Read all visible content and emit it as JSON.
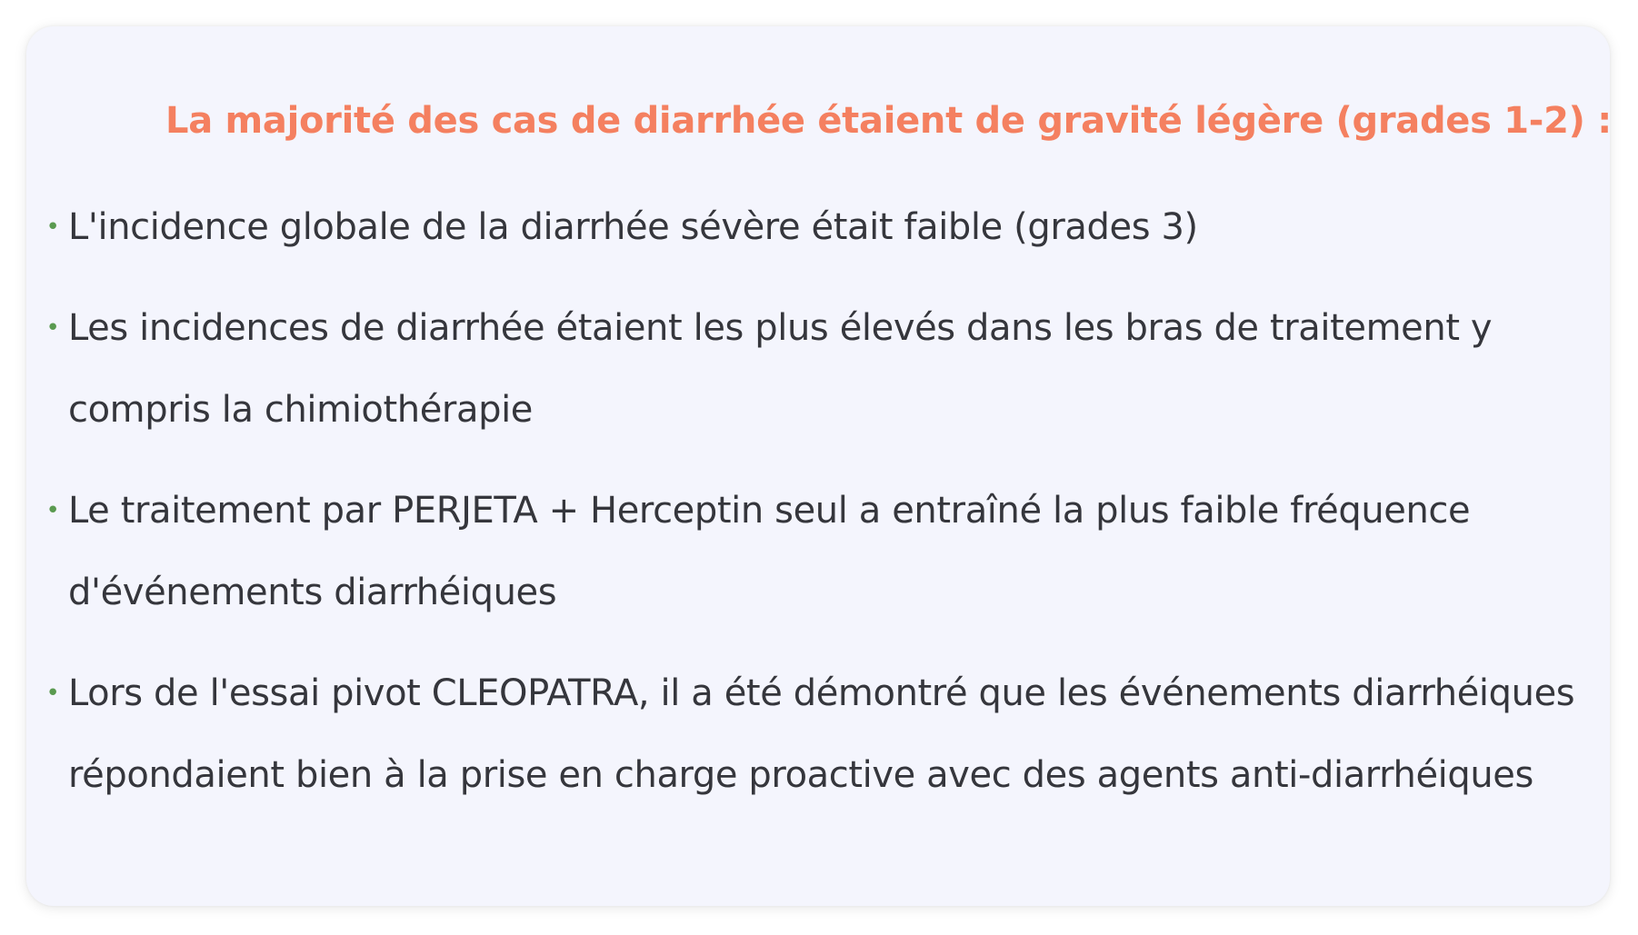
{
  "panel": {
    "headline": "La majorité des cas de diarrhée étaient de gravité légère (grades 1-2) :",
    "bullet_glyph": "•",
    "bullets": [
      {
        "text": "L'incidence globale de la diarrhée sévère était faible (grades  3)"
      },
      {
        "text": "Les incidences de diarrhée étaient les plus élevés dans les bras de traitement y compris la chimiothérapie"
      },
      {
        "text": "Le traitement par PERJETA + Herceptin seul a entraîné la plus faible fréquence d'événements diarrhéiques"
      },
      {
        "text": "Lors de l'essai pivot CLEOPATRA, il a été démontré que les événements diarrhéiques répondaient bien à la prise en charge proactive avec des agents anti-diarrhéiques"
      }
    ]
  },
  "colors": {
    "headline": "#f48060",
    "body_text": "#35363c",
    "bullet": "#5a9a50",
    "card_background": "#f4f5fd"
  }
}
